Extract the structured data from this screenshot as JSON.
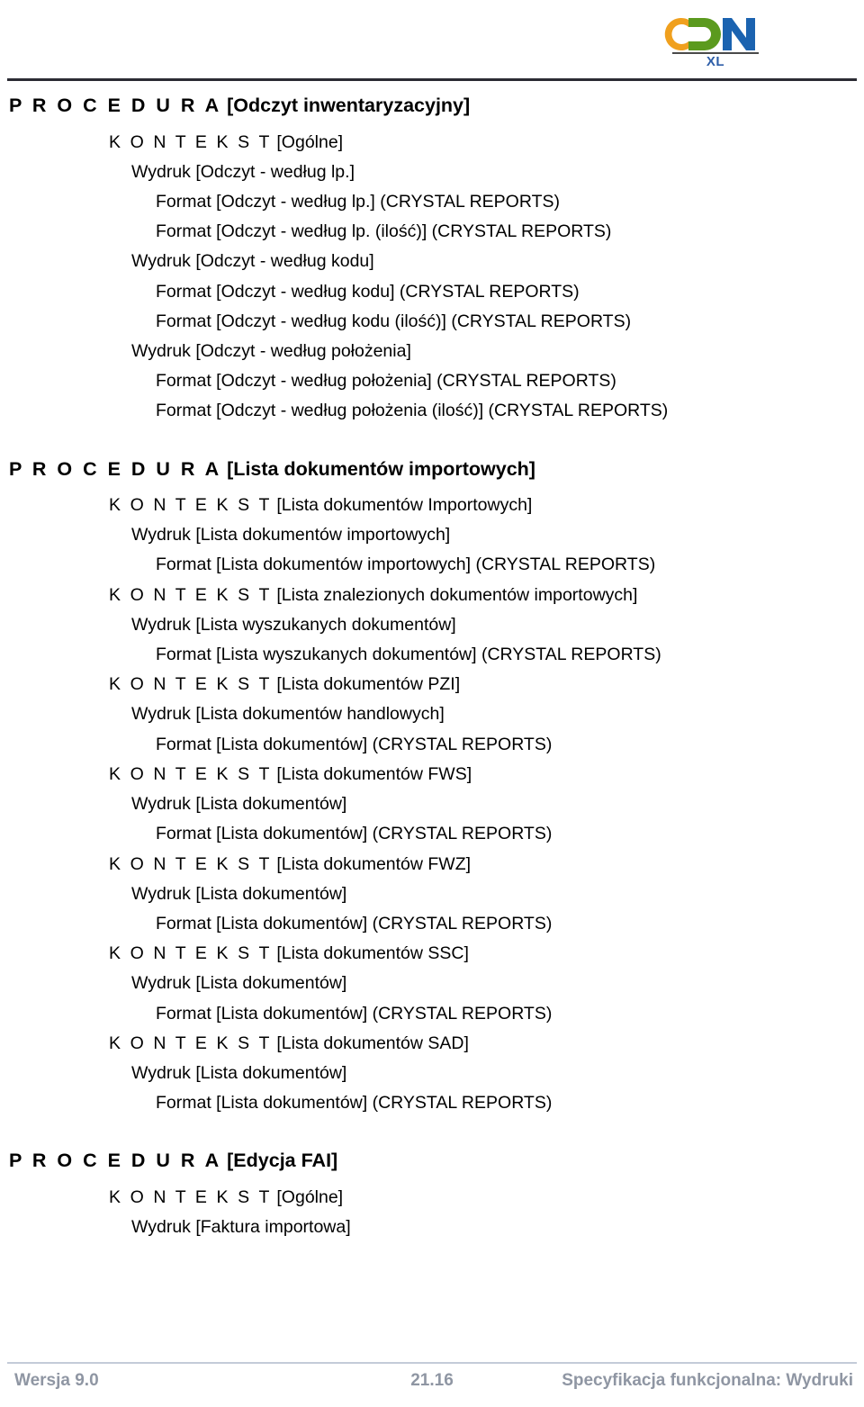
{
  "header": {
    "logo": {
      "name": "CDN XL",
      "letters": [
        "C",
        "D",
        "N"
      ],
      "subtitle": "XL",
      "colors": {
        "c": "#f0a01e",
        "d": "#5b9a1e",
        "n": "#1b63b0",
        "subtitle": "#2e5ea8",
        "rule": "#4a4a4a"
      }
    },
    "rule_color": "#2b2b33"
  },
  "sections": [
    {
      "heading_prefix": "P R O C E D U R A",
      "heading_suffix": " [Odczyt inwentaryzacyjny]",
      "lines": [
        {
          "level": "kontekst",
          "prefix": "K O N T E K S T",
          "suffix": " [Ogólne]"
        },
        {
          "level": "wydruk",
          "text": "Wydruk [Odczyt - według lp.]"
        },
        {
          "level": "format",
          "text": "Format [Odczyt - według lp.] (CRYSTAL REPORTS)"
        },
        {
          "level": "format",
          "text": "Format [Odczyt - według lp. (ilość)] (CRYSTAL REPORTS)"
        },
        {
          "level": "wydruk",
          "text": "Wydruk [Odczyt - według kodu]"
        },
        {
          "level": "format",
          "text": "Format [Odczyt - według kodu] (CRYSTAL REPORTS)"
        },
        {
          "level": "format",
          "text": "Format [Odczyt - według kodu (ilość)] (CRYSTAL REPORTS)"
        },
        {
          "level": "wydruk",
          "text": "Wydruk [Odczyt - według położenia]"
        },
        {
          "level": "format",
          "text": "Format [Odczyt - według położenia] (CRYSTAL REPORTS)"
        },
        {
          "level": "format",
          "text": "Format [Odczyt - według położenia (ilość)] (CRYSTAL REPORTS)"
        }
      ]
    },
    {
      "heading_prefix": "P R O C E D U R A",
      "heading_suffix": " [Lista dokumentów importowych]",
      "lines": [
        {
          "level": "kontekst",
          "prefix": "K O N T E K S T",
          "suffix": " [Lista dokumentów Importowych]"
        },
        {
          "level": "wydruk",
          "text": "Wydruk [Lista dokumentów importowych]"
        },
        {
          "level": "format",
          "text": "Format [Lista dokumentów importowych] (CRYSTAL REPORTS)"
        },
        {
          "level": "kontekst",
          "prefix": "K O N T E K S T",
          "suffix": " [Lista znalezionych dokumentów importowych]"
        },
        {
          "level": "wydruk",
          "text": "Wydruk [Lista wyszukanych dokumentów]"
        },
        {
          "level": "format",
          "text": "Format [Lista wyszukanych dokumentów] (CRYSTAL REPORTS)"
        },
        {
          "level": "kontekst",
          "prefix": "K O N T E K S T",
          "suffix": " [Lista dokumentów PZI]"
        },
        {
          "level": "wydruk",
          "text": "Wydruk [Lista dokumentów handlowych]"
        },
        {
          "level": "format",
          "text": "Format [Lista dokumentów] (CRYSTAL REPORTS)"
        },
        {
          "level": "kontekst",
          "prefix": "K O N T E K S T",
          "suffix": " [Lista dokumentów FWS]"
        },
        {
          "level": "wydruk",
          "text": "Wydruk [Lista dokumentów]"
        },
        {
          "level": "format",
          "text": "Format [Lista dokumentów] (CRYSTAL REPORTS)"
        },
        {
          "level": "kontekst",
          "prefix": "K O N T E K S T",
          "suffix": " [Lista dokumentów FWZ]"
        },
        {
          "level": "wydruk",
          "text": "Wydruk [Lista dokumentów]"
        },
        {
          "level": "format",
          "text": "Format [Lista dokumentów] (CRYSTAL REPORTS)"
        },
        {
          "level": "kontekst",
          "prefix": "K O N T E K S T",
          "suffix": " [Lista dokumentów SSC]"
        },
        {
          "level": "wydruk",
          "text": "Wydruk [Lista dokumentów]"
        },
        {
          "level": "format",
          "text": "Format [Lista dokumentów] (CRYSTAL REPORTS)"
        },
        {
          "level": "kontekst",
          "prefix": "K O N T E K S T",
          "suffix": " [Lista dokumentów SAD]"
        },
        {
          "level": "wydruk",
          "text": "Wydruk [Lista dokumentów]"
        },
        {
          "level": "format",
          "text": "Format [Lista dokumentów] (CRYSTAL REPORTS)"
        }
      ]
    },
    {
      "heading_prefix": "P R O C E D U R A",
      "heading_suffix": " [Edycja FAI]",
      "lines": [
        {
          "level": "kontekst",
          "prefix": "K O N T E K S T",
          "suffix": " [Ogólne]"
        },
        {
          "level": "wydruk",
          "text": "Wydruk [Faktura importowa]"
        }
      ]
    }
  ],
  "footer": {
    "version": "Wersja 9.0",
    "page_number": "21.16",
    "document_title": "Specyfikacja funkcjonalna: Wydruki",
    "text_color": "#8f96a3",
    "rule_color": "#c4cbd8"
  }
}
